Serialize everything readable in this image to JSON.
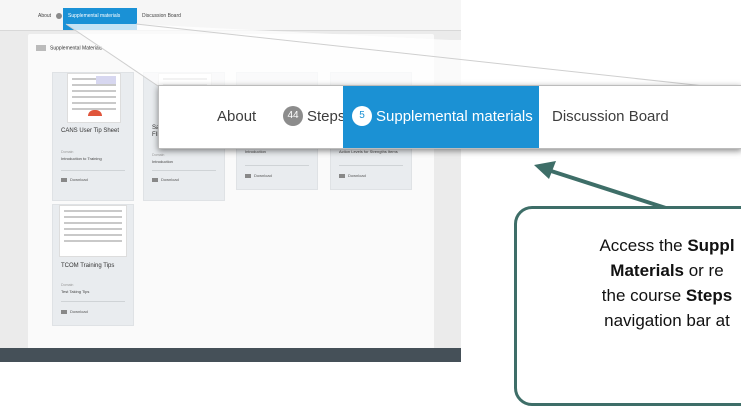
{
  "background_nav": {
    "about": "About",
    "steps": "Steps",
    "supplemental": "Supplemental materials",
    "discussion": "Discussion Board"
  },
  "section_title": "Supplemental Materials",
  "cards": [
    {
      "title": "CANS User Tip Sheet",
      "domain_label": "Domain",
      "domain": "Introduction to Training",
      "download": "Download"
    },
    {
      "title": "San Diego FINAL",
      "domain_label": "Domain",
      "domain": "Introduction",
      "download": "Download"
    },
    {
      "title": "",
      "domain_label": "Domain",
      "domain": "Introduction",
      "download": "Download"
    },
    {
      "title": "",
      "domain_label": "Domain",
      "domain": "Action Levels for Strengths Items",
      "download": "Download"
    },
    {
      "title": "TCOM Training Tips",
      "domain_label": "Domain",
      "domain": "Test Taking Tips",
      "download": "Download"
    }
  ],
  "zoom_nav": {
    "about": "About",
    "steps_count": "44",
    "steps": "Steps",
    "supplemental_count": "5",
    "supplemental": "Supplemental materials",
    "discussion": "Discussion Board"
  },
  "annotation": {
    "part1": "Access the ",
    "bold1": "Suppl",
    "bold2": "Materials",
    "part2": " or re",
    "part3": "the course ",
    "bold3": "Steps",
    "part4": "navigation bar at"
  },
  "colors": {
    "accent": "#1b91d4",
    "arrow": "#3e6e68",
    "footer": "#455058"
  }
}
